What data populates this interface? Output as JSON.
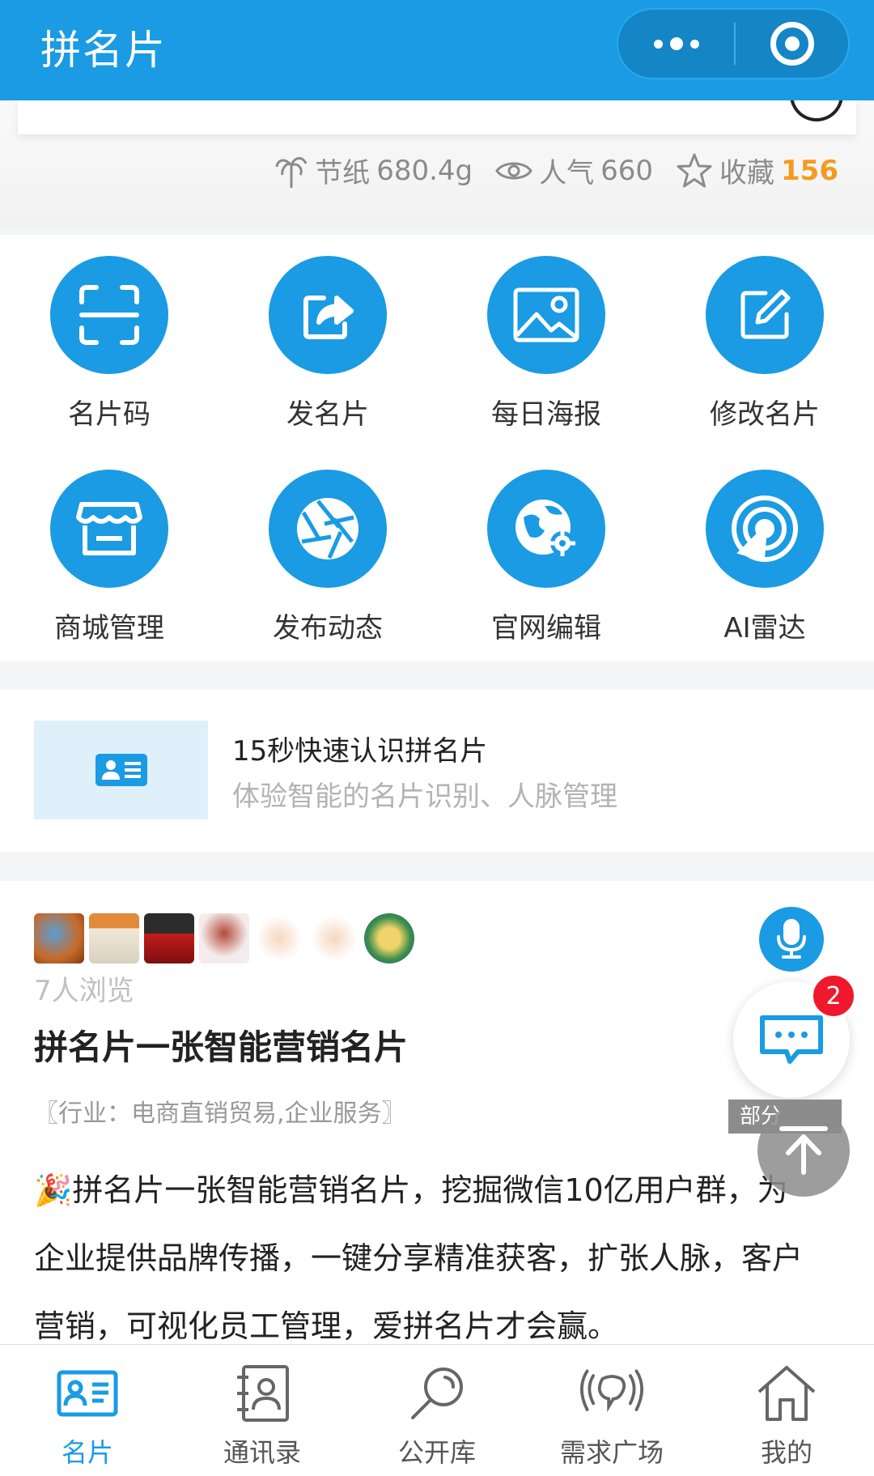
{
  "header": {
    "title": "拼名片",
    "more_icon": "more-dots-icon",
    "close_icon": "target-close-icon"
  },
  "stats": {
    "paper_label": "节纸",
    "paper_value": "680.4g",
    "views_label": "人气",
    "views_value": "660",
    "fav_label": "收藏",
    "fav_value": "156"
  },
  "grid": [
    {
      "label": "名片码",
      "icon": "scan-frame-icon"
    },
    {
      "label": "发名片",
      "icon": "share-icon"
    },
    {
      "label": "每日海报",
      "icon": "image-icon"
    },
    {
      "label": "修改名片",
      "icon": "edit-icon"
    },
    {
      "label": "商城管理",
      "icon": "store-icon"
    },
    {
      "label": "发布动态",
      "icon": "aperture-icon"
    },
    {
      "label": "官网编辑",
      "icon": "globe-gear-icon"
    },
    {
      "label": "AI雷达",
      "icon": "radar-icon"
    }
  ],
  "intro": {
    "title": "15秒快速认识拼名片",
    "subtitle": "体验智能的名片识别、人脉管理"
  },
  "detail": {
    "views": "7人浏览",
    "headline": "拼名片一张智能营销名片",
    "industry": "〖行业：电商直销贸易,企业服务〗",
    "desc": "🎉拼名片一张智能营销名片，挖掘微信10亿用户群，为企业提供品牌传播，一键分享精准获客，扩张人脉，客户营销，可视化员工管理，爱拼名片才会赢。",
    "badge_count": "2",
    "part_tag": "部分"
  },
  "tabs": [
    {
      "label": "名片",
      "icon": "card-icon",
      "active": true
    },
    {
      "label": "通讯录",
      "icon": "contacts-icon",
      "active": false
    },
    {
      "label": "公开库",
      "icon": "search-icon",
      "active": false
    },
    {
      "label": "需求广场",
      "icon": "broadcast-icon",
      "active": false
    },
    {
      "label": "我的",
      "icon": "home-icon",
      "active": false
    }
  ],
  "colors": {
    "primary": "#1a9be3",
    "accent_orange": "#f39b1f",
    "badge_red": "#f0182c"
  }
}
